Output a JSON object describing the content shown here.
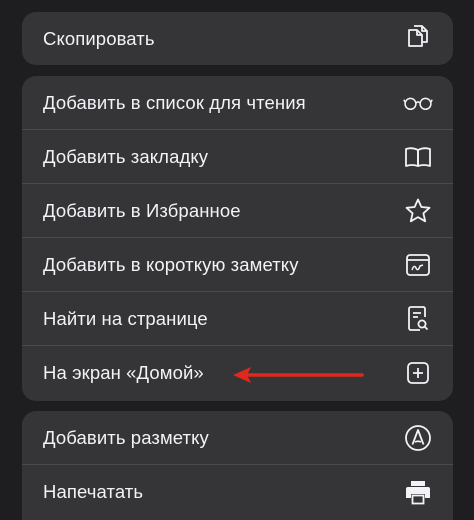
{
  "menu": {
    "group1": [
      {
        "label": "Скопировать",
        "icon": "copy-icon"
      }
    ],
    "group2": [
      {
        "label": "Добавить в список для чтения",
        "icon": "glasses-icon"
      },
      {
        "label": "Добавить закладку",
        "icon": "book-icon"
      },
      {
        "label": "Добавить в Избранное",
        "icon": "star-icon"
      },
      {
        "label": "Добавить в короткую заметку",
        "icon": "quick-note-icon"
      },
      {
        "label": "Найти на странице",
        "icon": "find-on-page-icon"
      },
      {
        "label": "На экран «Домой»",
        "icon": "add-square-icon"
      }
    ],
    "group3": [
      {
        "label": "Добавить разметку",
        "icon": "markup-pen-icon"
      },
      {
        "label": "Напечатать",
        "icon": "printer-icon"
      }
    ]
  },
  "annotation": {
    "arrow_color": "#e0281e",
    "points_to": "На экран «Домой»"
  },
  "colors": {
    "background": "#1e1e20",
    "group": "#353538",
    "text": "#f2f2f7",
    "separator": "#4a4a4e"
  }
}
